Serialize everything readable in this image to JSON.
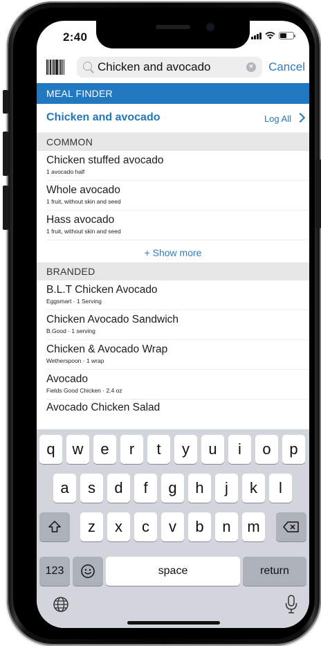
{
  "status_bar": {
    "time": "2:40",
    "battery_level": 0.5
  },
  "search": {
    "query": "Chicken and avocado",
    "cancel_label": "Cancel"
  },
  "meal_finder": {
    "label": "MEAL FINDER",
    "title": "Chicken and avocado",
    "log_all_label": "Log All"
  },
  "common": {
    "header": "COMMON",
    "items": [
      {
        "name": "Chicken stuffed avocado",
        "desc": "1 avocado half"
      },
      {
        "name": "Whole avocado",
        "desc": "1 fruit, without skin and seed"
      },
      {
        "name": "Hass avocado",
        "desc": "1 fruit, without skin and seed"
      }
    ],
    "show_more_label": "+ Show more"
  },
  "branded": {
    "header": "BRANDED",
    "items": [
      {
        "name": "B.L.T Chicken Avocado",
        "desc": "Eggsmart · 1 Serving"
      },
      {
        "name": "Chicken Avocado Sandwich",
        "desc": "B.Good · 1 serving"
      },
      {
        "name": "Chicken & Avocado Wrap",
        "desc": "Wetherspoon · 1 wrap"
      },
      {
        "name": "Avocado",
        "desc": "Fields Good Chicken · 2.4 oz"
      }
    ],
    "partial_item": "Avocado Chicken Salad"
  },
  "keyboard": {
    "row1": [
      "q",
      "w",
      "e",
      "r",
      "t",
      "y",
      "u",
      "i",
      "o",
      "p"
    ],
    "row2": [
      "a",
      "s",
      "d",
      "f",
      "g",
      "h",
      "j",
      "k",
      "l"
    ],
    "row3": [
      "z",
      "x",
      "c",
      "v",
      "b",
      "n",
      "m"
    ],
    "numbers_label": "123",
    "space_label": "space",
    "return_label": "return"
  },
  "colors": {
    "accent": "#2179c2",
    "link": "#2c7dc2",
    "keyboard_bg": "#d2d5db"
  }
}
